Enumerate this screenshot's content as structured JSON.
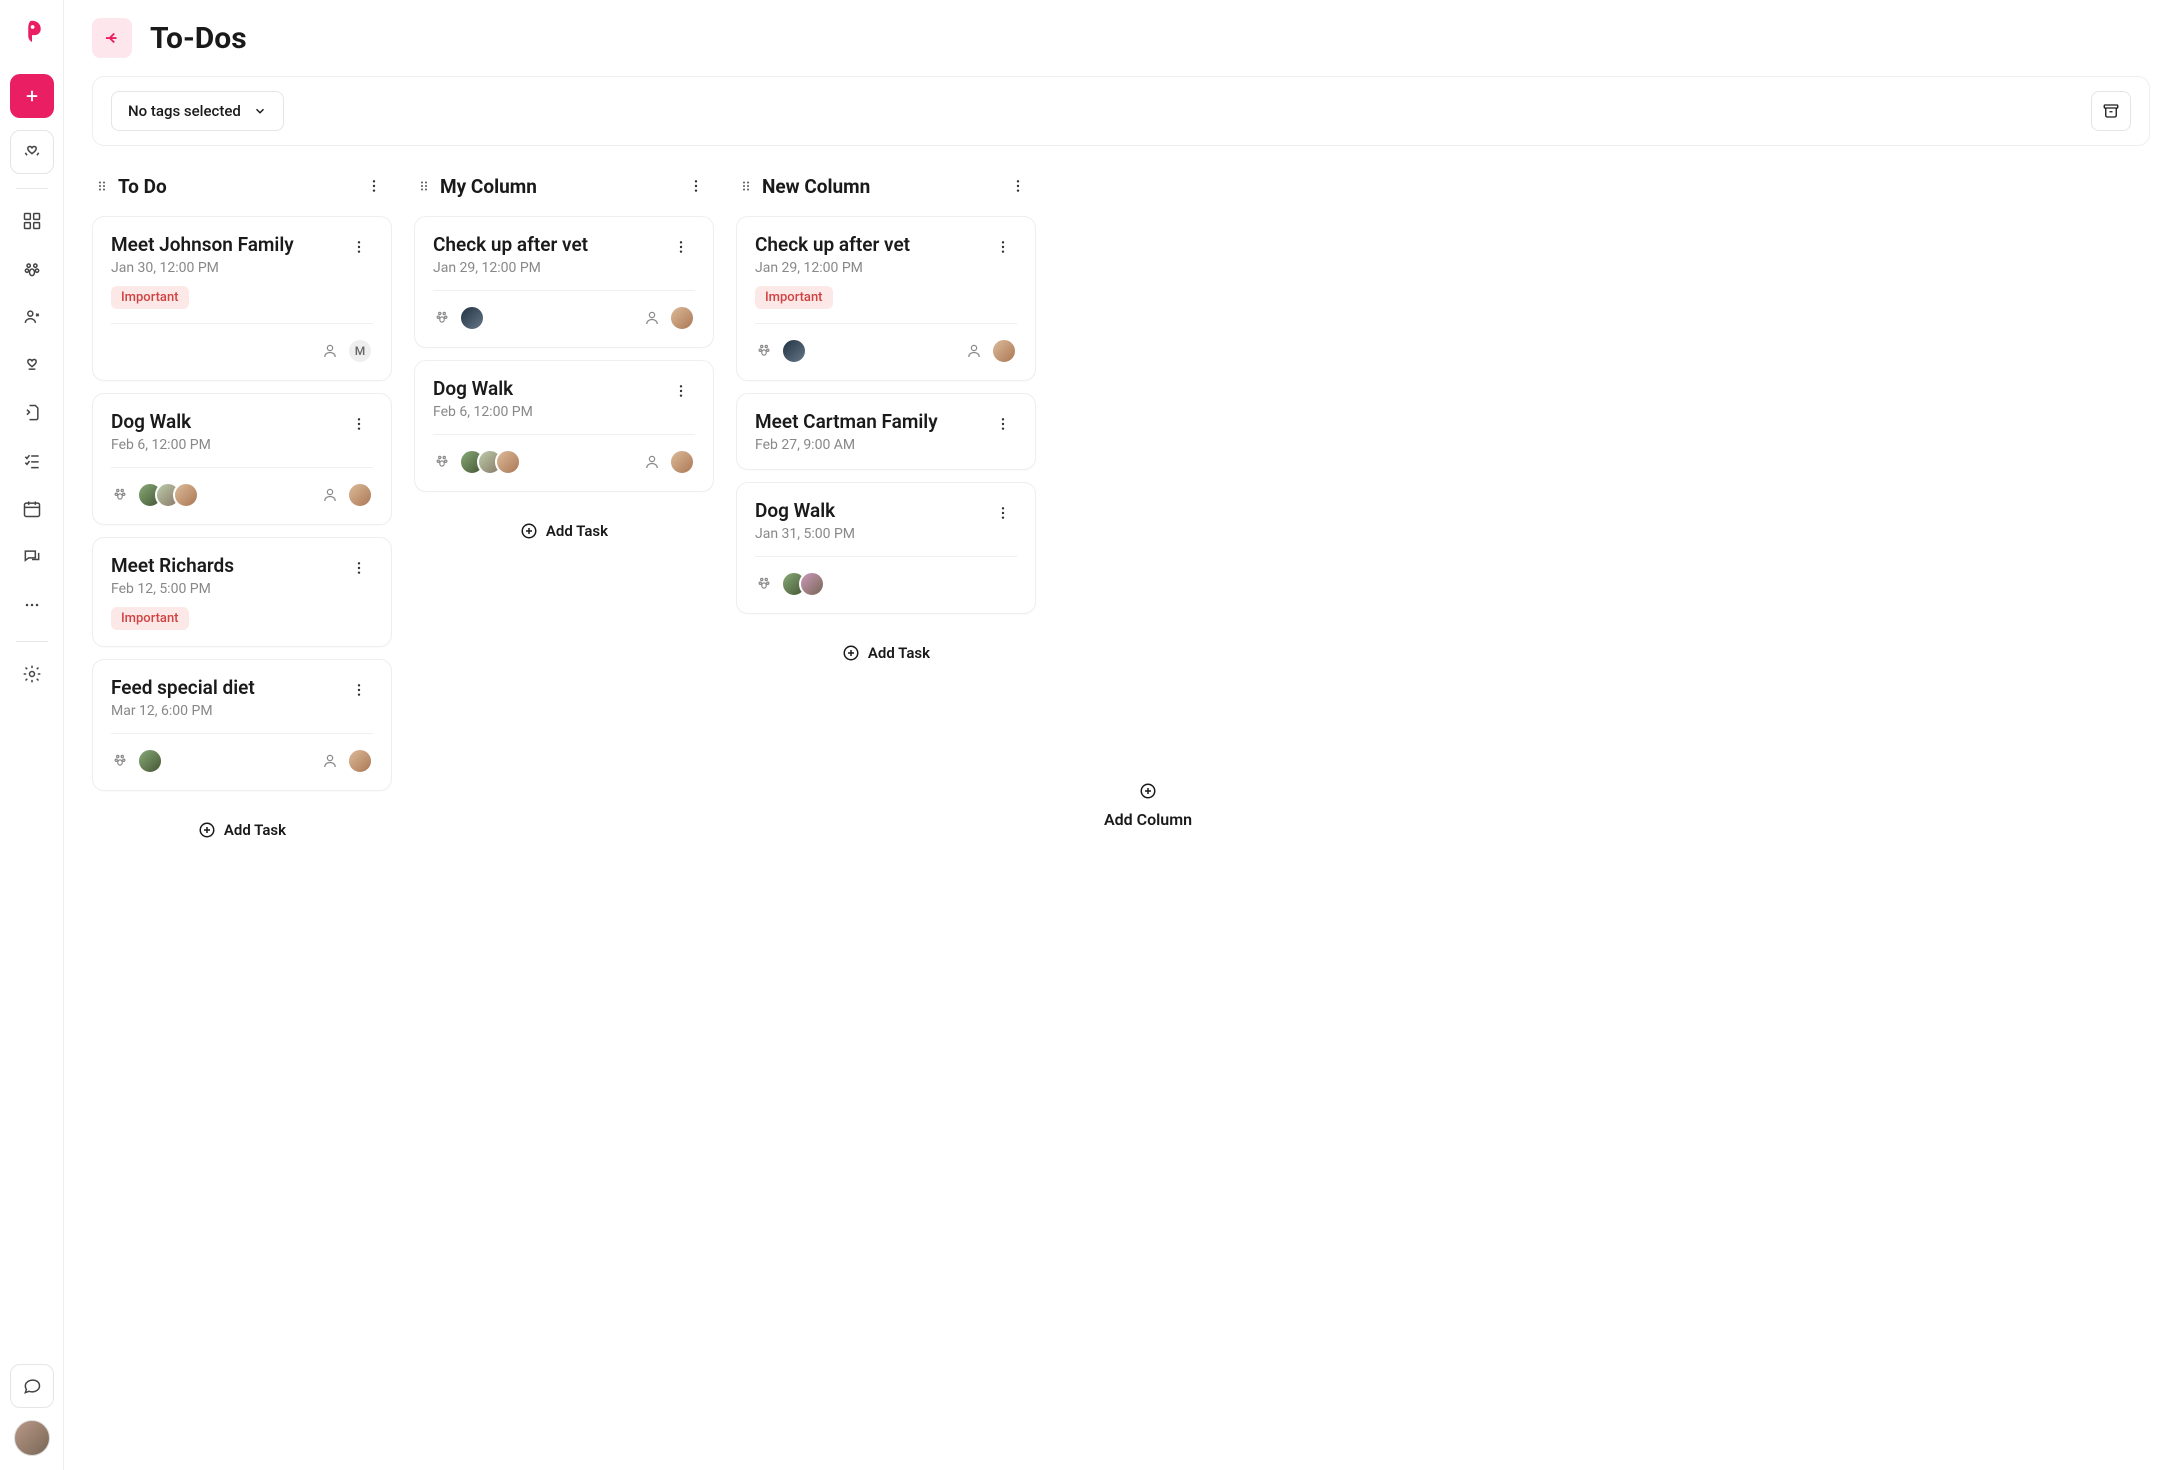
{
  "app": {
    "title": "To-Dos"
  },
  "filter": {
    "tags_label": "No tags selected"
  },
  "actions": {
    "add_task": "Add Task",
    "add_column": "Add Column"
  },
  "tags": {
    "important": "Important"
  },
  "columns": [
    {
      "title": "To Do",
      "tasks": [
        {
          "title": "Meet Johnson Family",
          "date": "Jan 30, 12:00 PM",
          "tag": "important",
          "pets": [],
          "assignee_letter": "M"
        },
        {
          "title": "Dog Walk",
          "date": "Feb 6, 12:00 PM",
          "pets": [
            "av1",
            "av2",
            "av3"
          ],
          "assignees": [
            "av3"
          ]
        },
        {
          "title": "Meet Richards",
          "date": "Feb 12, 5:00 PM",
          "tag": "important"
        },
        {
          "title": "Feed special diet",
          "date": "Mar 12, 6:00 PM",
          "pets": [
            "av1"
          ],
          "assignees": [
            "av3"
          ]
        }
      ]
    },
    {
      "title": "My Column",
      "tasks": [
        {
          "title": "Check up after vet",
          "date": "Jan 29, 12:00 PM",
          "pets": [
            "av4"
          ],
          "assignees": [
            "av3"
          ]
        },
        {
          "title": "Dog Walk",
          "date": "Feb 6, 12:00 PM",
          "pets": [
            "av1",
            "av2",
            "av3"
          ],
          "assignees": [
            "av3"
          ]
        }
      ]
    },
    {
      "title": "New Column",
      "tasks": [
        {
          "title": "Check up after vet",
          "date": "Jan 29, 12:00 PM",
          "tag": "important",
          "pets": [
            "av4"
          ],
          "assignees": [
            "av3"
          ]
        },
        {
          "title": "Meet Cartman Family",
          "date": "Feb 27, 9:00 AM"
        },
        {
          "title": "Dog Walk",
          "date": "Jan 31, 5:00 PM",
          "pets": [
            "av1",
            "av5"
          ]
        }
      ]
    }
  ]
}
